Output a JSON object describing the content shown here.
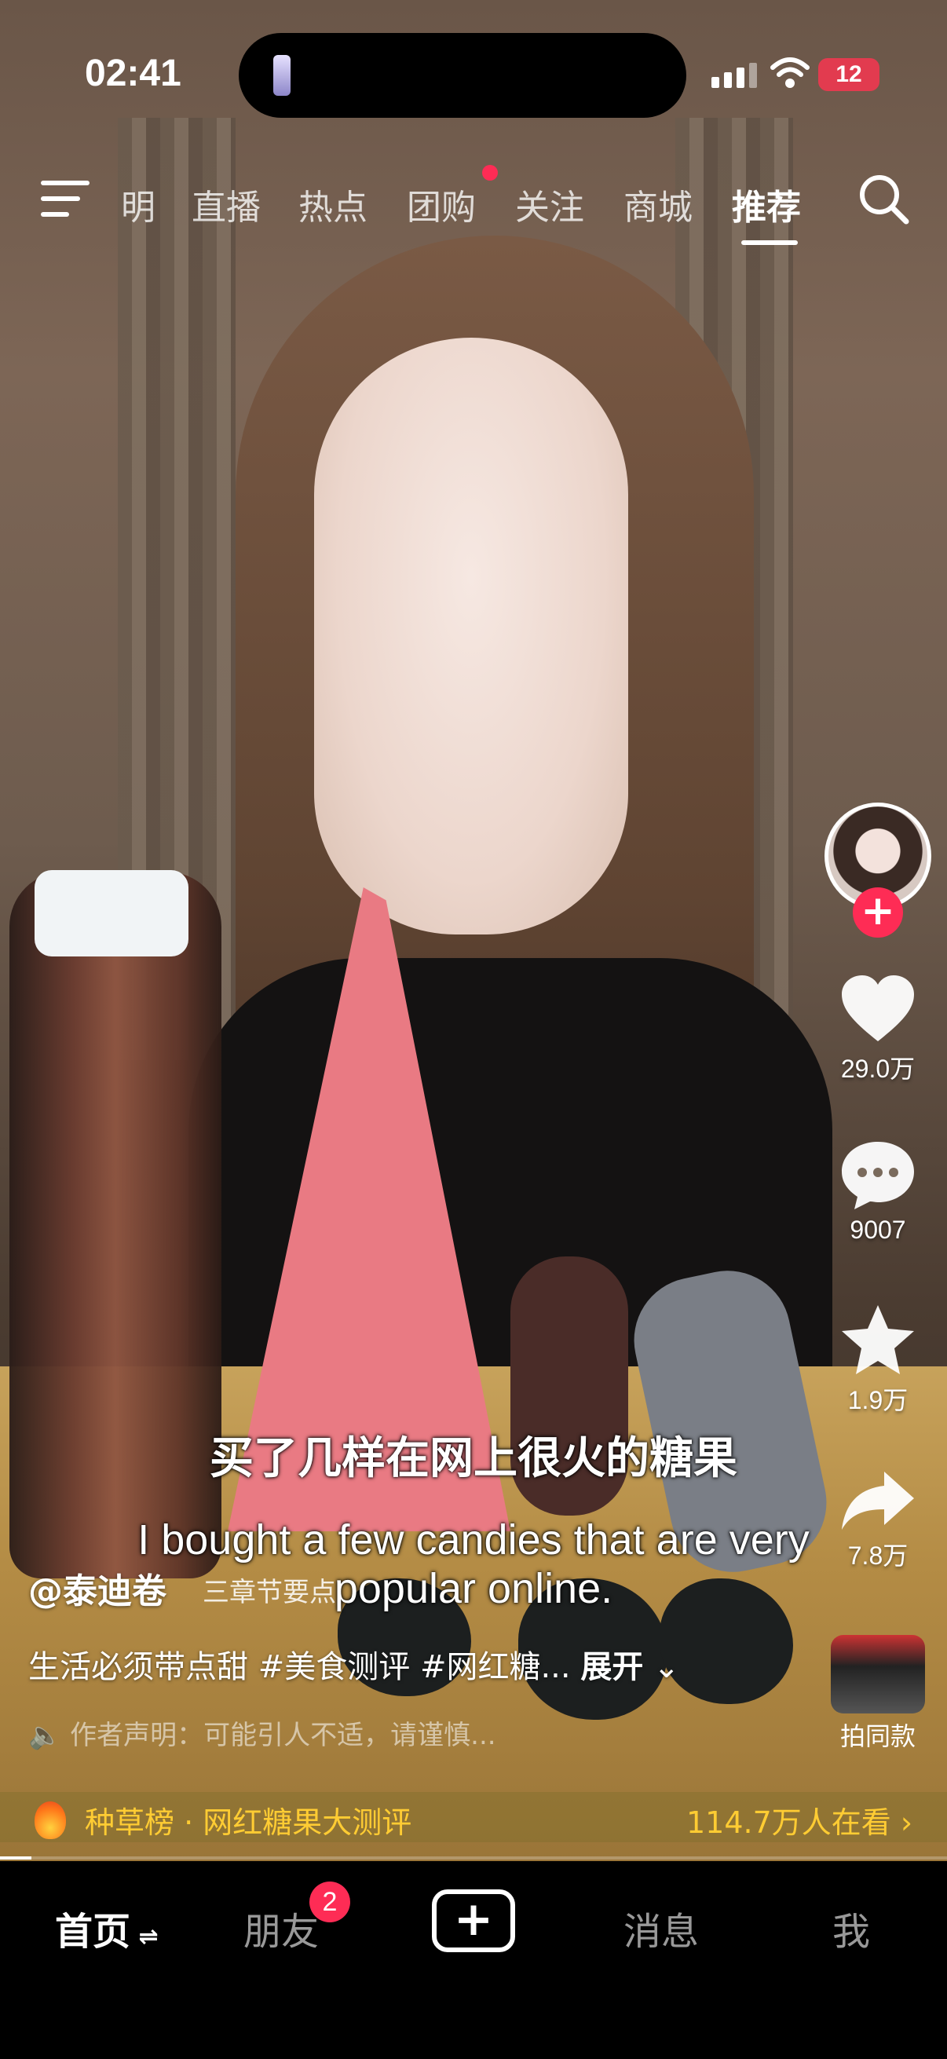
{
  "status_bar": {
    "time": "02:41",
    "battery": "12"
  },
  "top_nav": {
    "tabs": [
      "明",
      "直播",
      "热点",
      "团购",
      "关注",
      "商城",
      "推荐"
    ],
    "active_tab": "推荐"
  },
  "video": {
    "subtitle_cn": "买了几样在网上很火的糖果",
    "subtitle_en": "I bought a few candies that are very popular online."
  },
  "actions": {
    "likes": "29.0万",
    "comments": "9007",
    "favorites": "1.9万",
    "shares": "7.8万"
  },
  "caption": {
    "author": "@泰迪卷",
    "chapter": "三章节要点",
    "description": "生活必须带点甜 #美食测评 #网红糖...",
    "expand": "展开",
    "notice": "作者声明：可能引人不适，请谨慎..."
  },
  "same_style": {
    "label": "拍同款"
  },
  "hot_list": {
    "text": "种草榜 · 网红糖果大测评",
    "viewers": "114.7万人在看"
  },
  "bottom_nav": {
    "home": "首页",
    "friends": "朋友",
    "friends_badge": "2",
    "messages": "消息",
    "me": "我"
  },
  "colors": {
    "accent": "#fe2c55",
    "hot": "#ffcc33"
  }
}
